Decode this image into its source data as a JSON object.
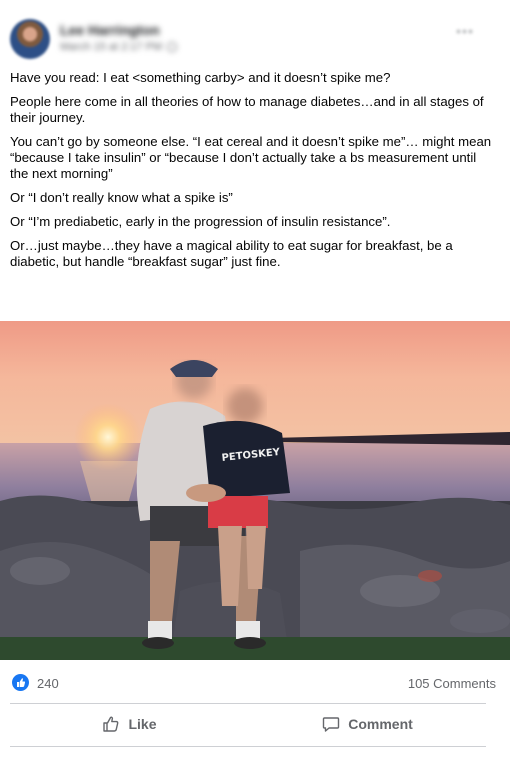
{
  "author": {
    "name": "Lee Harrington",
    "meta": "March 15 at 2:17 PM"
  },
  "post": {
    "paragraphs": [
      "Have you read:  I eat <something carby> and it doesn’t spike me?",
      "People here come in all theories of how to manage diabetes…and in all stages of their journey.",
      "You can’t go by someone else.  “I eat cereal and it doesn’t spike me”… might mean “because I take insulin” or “because I don’t actually take a bs measurement until the next morning”",
      "Or “I don’t really know what a spike is”",
      "Or “I’m prediabetic, early in the progression of insulin resistance”.",
      "Or…just maybe…they have a magical ability to eat sugar for breakfast, be a diabetic, but handle “breakfast sugar” just fine."
    ],
    "photo": {
      "shirt_text": "PETOSKEY"
    }
  },
  "stats": {
    "likes": "240",
    "comments": "105 Comments"
  },
  "actions": {
    "like_label": "Like",
    "comment_label": "Comment"
  },
  "colors": {
    "accent": "#1877f2",
    "muted_text": "#65676b",
    "divider": "#ced0d4"
  },
  "icons": {
    "reaction": "thumbs-up-icon",
    "more": "more-options-icon",
    "privacy": "globe-icon"
  }
}
